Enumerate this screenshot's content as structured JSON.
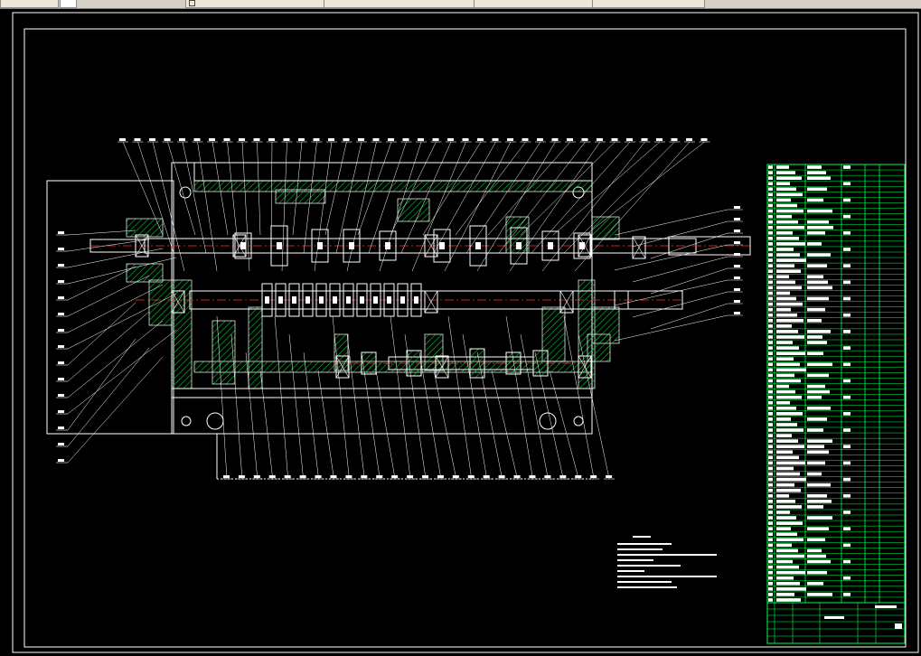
{
  "tabs": [
    {
      "label": "",
      "active": true
    },
    {
      "label": "",
      "active": false
    },
    {
      "label": "",
      "active": false
    },
    {
      "label": "",
      "active": false
    },
    {
      "label": "",
      "active": false
    },
    {
      "label": "",
      "active": false
    }
  ],
  "colors": {
    "background": "#000000",
    "linework": "#ffffff",
    "hatch": "#00cc33",
    "centerline": "#ff3030",
    "table_grid": "#00ff44",
    "leader": "#ffffff"
  },
  "drawing": {
    "type": "gearbox-assembly-section",
    "top_balloons": 40,
    "bottom_balloons": 26,
    "left_balloons": 15,
    "right_balloons": 10,
    "parts_list_rows": 80
  }
}
